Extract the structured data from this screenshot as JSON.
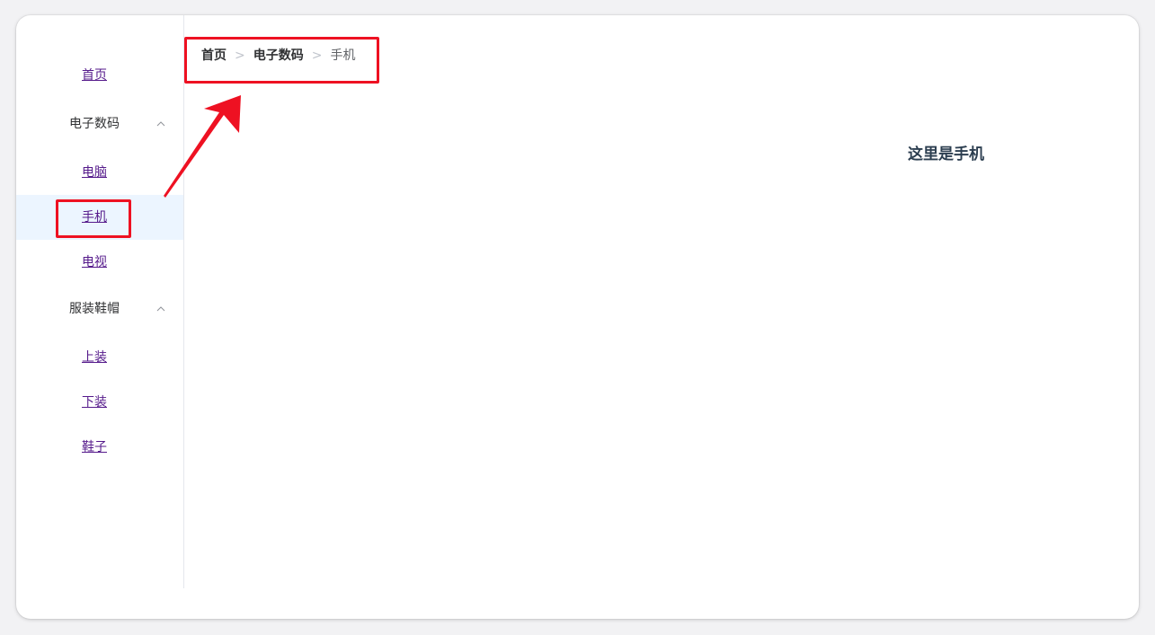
{
  "sidebar": {
    "home": "首页",
    "group_electronics": "电子数码",
    "computer": "电脑",
    "phone": "手机",
    "tv": "电视",
    "group_apparel": "服装鞋帽",
    "tops": "上装",
    "bottoms": "下装",
    "shoes": "鞋子"
  },
  "breadcrumb": {
    "items": [
      "首页",
      "电子数码",
      "手机"
    ],
    "separator": ">"
  },
  "content": {
    "title": "这里是手机"
  },
  "colors": {
    "active_bg": "#ecf5ff",
    "link": "#551a8b",
    "annotation": "#ee1122"
  },
  "icons": {
    "submenu_arrow": "chevron-up-icon",
    "separator": "chevron-right-icon"
  }
}
